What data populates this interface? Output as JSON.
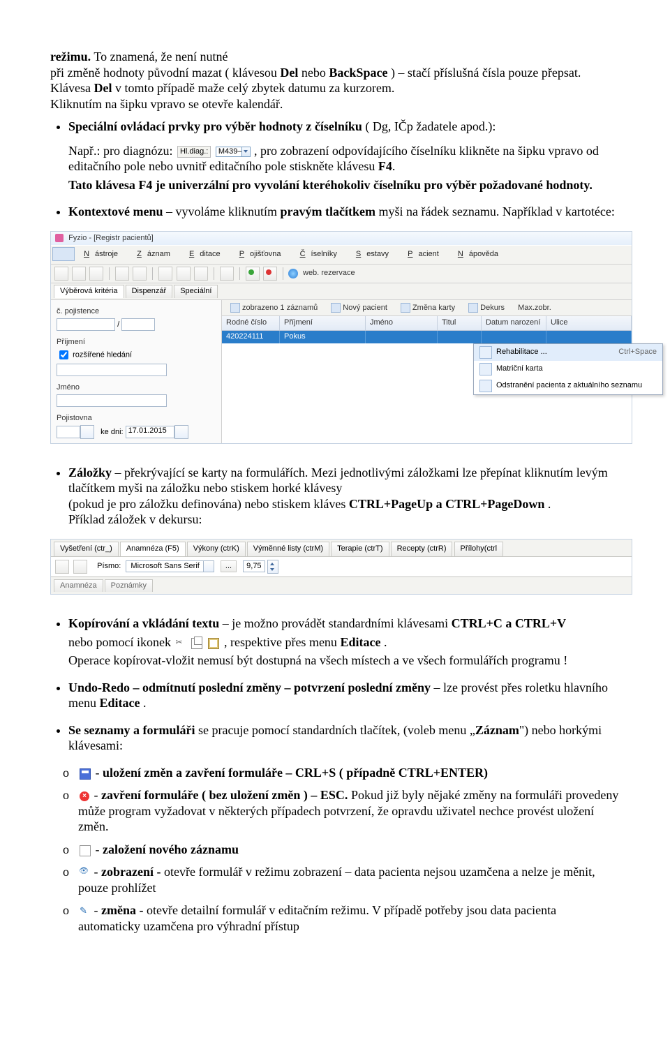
{
  "intro": {
    "l1a": "režimu.",
    "l1b": " To znamená, že není nutné",
    "l2a": "při změně hodnoty původní mazat ( klávesou ",
    "l2b": "Del",
    "l2c": " nebo ",
    "l2d": "BackSpace",
    "l2e": " ) – stačí příslušná čísla pouze přepsat.",
    "l3a": "Klávesa ",
    "l3b": "Del",
    "l3c": "  v tomto případě maže celý zbytek datumu za kurzorem.",
    "l4": "Kliknutím na šipku vpravo se otevře kalendář."
  },
  "spec": {
    "head_a": "Speciální ovládací prvky pro výběr hodnoty z číselníku",
    "head_b": " ( Dg, IČp žadatele apod.):",
    "np_a": "Např.: pro diagnózu: ",
    "mini_label": "Hl.diag.:",
    "mini_value": "M439–",
    "np_b": ", pro zobrazení odpovídajícího číselníku klikněte na šipku vpravo od editačního pole nebo uvnitř editačního pole stiskněte klávesu ",
    "np_c": "F4",
    "np_d": ".",
    "tato_a": "Tato klávesa F4 je univerzální pro vyvolání kteréhokoliv číselníku pro výběr požadované hodnoty."
  },
  "kontext": {
    "a": "Kontextové menu",
    "b": " – vyvoláme kliknutím ",
    "c": "pravým tlačítkem",
    "d": " myši na řádek seznamu. Například v kartotéce:"
  },
  "app1": {
    "title": "Fyzio  - [Registr pacientů]",
    "menu": [
      "Nástroje",
      "Záznam",
      "Editace",
      "Pojišťovna",
      "Číselníky",
      "Sestavy",
      "Pacient",
      "Nápověda"
    ],
    "menu_u": [
      "N",
      "Z",
      "E",
      "P",
      "Č",
      "S",
      "P",
      "N"
    ],
    "web": "web. rezervace",
    "tabs2": [
      "Výběrová kritéria",
      "Dispenzář",
      "Speciální"
    ],
    "rtabs": [
      "zobrazeno 1 záznamů",
      "Nový pacient",
      "Změna karty",
      "Dekurs",
      "Max.zobr."
    ],
    "left": {
      "lbl_cpoj": "č. pojistence",
      "lbl_slash": "/",
      "lbl_prij": "Příjmení",
      "chk_label": "rozšířené hledání",
      "lbl_jmeno": "Jméno",
      "lbl_poj": "Pojistovna",
      "lbl_kedni": "ke dni:",
      "date": "17.01.2015"
    },
    "cols": [
      "Rodné číslo",
      "Příjmení",
      "Jméno",
      "Titul",
      "Datum narození",
      "Ulice"
    ],
    "row": [
      "420224111",
      "Pokus",
      "",
      "",
      "",
      ""
    ],
    "ctx": [
      {
        "t": "Rehabilitace ...",
        "acc": "Ctrl+Space"
      },
      {
        "t": "Matriční karta",
        "acc": ""
      },
      {
        "t": "Odstranění pacienta z aktuálního seznamu",
        "acc": ""
      }
    ]
  },
  "zal": {
    "a": "Záložky",
    "b": " – překrývající se karty na formulářích. Mezi jednotlivými záložkami lze přepínat kliknutím levým tlačítkem myši na záložku nebo stiskem horké klávesy",
    "c": " (pokud je pro záložku definována) nebo stiskem kláves ",
    "d": "CTRL+PageUp a CTRL+PageDown",
    "e": " .",
    "f": "Příklad záložek v dekursu:"
  },
  "app2": {
    "tabs": [
      "Vyšetření (ctr_)",
      "Anamnéza (F5)",
      "Výkony (ctrK)",
      "Výměnné listy (ctrM)",
      "Terapie (ctrT)",
      "Recepty (ctrR)",
      "Přílohy(ctrl"
    ],
    "sel": 1,
    "pismo_label": "Písmo:",
    "font_name": "Microsoft Sans Serif",
    "font_size": "9,75",
    "subtabs": [
      "Anamnéza",
      "Poznámky"
    ]
  },
  "kop": {
    "a": "Kopírování a vkládání textu",
    "b": " – je možno provádět standardními klávesami ",
    "c": "CTRL+C a CTRL+V",
    "d": "nebo pomocí ikonek ",
    "e": ", respektive přes menu ",
    "f": "Editace",
    "g": " .",
    "h": "Operace  kopírovat-vložit nemusí být dostupná na všech místech a ve všech formulářích programu !"
  },
  "undo": {
    "a": "Undo-Redo – odmítnutí poslední změny – potvrzení poslední změny",
    "b": " – lze provést přes roletku hlavního menu ",
    "c": "Editace",
    "d": " ."
  },
  "sezn": {
    "a": "Se seznamy a formuláři",
    "b": " se pracuje pomocí standardních tlačítek, (voleb menu „",
    "c": "Záznam",
    "d": "\") nebo horkými klávesami:"
  },
  "o1": {
    "a": " - ",
    "b": "uložení změn a zavření formuláře – CRL+S ( případně CTRL+ENTER)"
  },
  "o2": {
    "a": " - ",
    "b": "zavření formuláře ( bez uložení změn )  – ESC.",
    "c": " Pokud již byly nějaké změny na formuláři provedeny může program vyžadovat v některých případech potvrzení, že opravdu uživatel nechce provést uložení změn."
  },
  "o3": {
    "a": " - ",
    "b": "založení nového záznamu"
  },
  "o4": {
    "a": " - ",
    "b": "zobrazení -",
    "c": "  otevře formulář v režimu zobrazení – data pacienta nejsou uzamčena a nelze je měnit, pouze prohlížet"
  },
  "o5": {
    "a": " - ",
    "b": "změna -",
    "c": "  otevře detailní formulář v editačním režimu. V případě potřeby jsou data pacienta automaticky uzamčena pro výhradní přístup"
  }
}
